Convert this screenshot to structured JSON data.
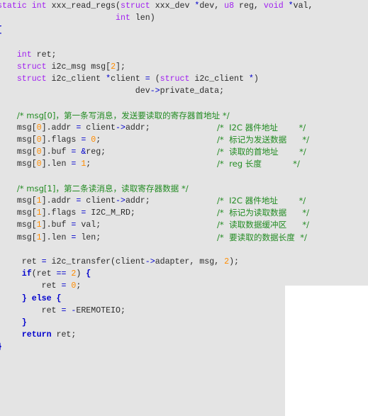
{
  "editor": {
    "language": "C",
    "background_color": "#e4e4e4",
    "comment_color": "#228b22",
    "keyword_color": "#a020f0",
    "control_keyword_color": "#0000cd",
    "number_color": "#ff8c00",
    "identifier_color": "#2b2b2b",
    "operator_color": "#0000cd"
  },
  "overlay": {
    "name": "white-panel",
    "color": "#ffffff"
  },
  "code": {
    "function_name": "xxx_read_regs",
    "lines": [
      {
        "id": "l1",
        "tokens": [
          {
            "t": "static",
            "c": "kw"
          },
          {
            "t": " ",
            "c": "punct"
          },
          {
            "t": "int",
            "c": "kw"
          },
          {
            "t": " ",
            "c": "punct"
          },
          {
            "t": "xxx_read_regs",
            "c": "ident"
          },
          {
            "t": "(",
            "c": "punct"
          },
          {
            "t": "struct",
            "c": "kw"
          },
          {
            "t": " ",
            "c": "punct"
          },
          {
            "t": "xxx_dev",
            "c": "ident"
          },
          {
            "t": " ",
            "c": "punct"
          },
          {
            "t": "*",
            "c": "op"
          },
          {
            "t": "dev, ",
            "c": "ident"
          },
          {
            "t": "u8",
            "c": "kw"
          },
          {
            "t": " ",
            "c": "punct"
          },
          {
            "t": "reg, ",
            "c": "ident"
          },
          {
            "t": "void",
            "c": "kw"
          },
          {
            "t": " ",
            "c": "punct"
          },
          {
            "t": "*",
            "c": "op"
          },
          {
            "t": "val,",
            "c": "ident"
          }
        ]
      },
      {
        "id": "l2",
        "tokens": [
          {
            "t": "                        ",
            "c": "punct"
          },
          {
            "t": "int",
            "c": "kw"
          },
          {
            "t": " ",
            "c": "punct"
          },
          {
            "t": "len)",
            "c": "ident"
          }
        ]
      },
      {
        "id": "l3",
        "tokens": [
          {
            "t": "{",
            "c": "brace"
          }
        ]
      },
      {
        "id": "l4",
        "tokens": []
      },
      {
        "id": "l5",
        "tokens": [
          {
            "t": "    ",
            "c": "punct"
          },
          {
            "t": "int",
            "c": "kw"
          },
          {
            "t": " ret;",
            "c": "ident"
          }
        ]
      },
      {
        "id": "l6",
        "tokens": [
          {
            "t": "    ",
            "c": "punct"
          },
          {
            "t": "struct",
            "c": "kw"
          },
          {
            "t": " i2c_msg msg",
            "c": "ident"
          },
          {
            "t": "[",
            "c": "punct"
          },
          {
            "t": "2",
            "c": "num"
          },
          {
            "t": "];",
            "c": "punct"
          }
        ]
      },
      {
        "id": "l7",
        "tokens": [
          {
            "t": "    ",
            "c": "punct"
          },
          {
            "t": "struct",
            "c": "kw"
          },
          {
            "t": " i2c_client ",
            "c": "ident"
          },
          {
            "t": "*",
            "c": "op"
          },
          {
            "t": "client ",
            "c": "ident"
          },
          {
            "t": "=",
            "c": "op"
          },
          {
            "t": " (",
            "c": "punct"
          },
          {
            "t": "struct",
            "c": "kw"
          },
          {
            "t": " i2c_client ",
            "c": "ident"
          },
          {
            "t": "*",
            "c": "op"
          },
          {
            "t": ")",
            "c": "punct"
          }
        ]
      },
      {
        "id": "l8",
        "tokens": [
          {
            "t": "                            dev",
            "c": "ident"
          },
          {
            "t": "->",
            "c": "op"
          },
          {
            "t": "private_data;",
            "c": "ident"
          }
        ]
      },
      {
        "id": "l9",
        "tokens": []
      },
      {
        "id": "l10",
        "tokens": [
          {
            "t": "    ",
            "c": "punct"
          },
          {
            "t": "/* msg[0]，第一条写消息，发送要读取的寄存器首地址 */",
            "c": "cmt"
          }
        ]
      },
      {
        "id": "l11",
        "tokens": [
          {
            "t": "    msg",
            "c": "ident"
          },
          {
            "t": "[",
            "c": "punct"
          },
          {
            "t": "0",
            "c": "num"
          },
          {
            "t": "].addr ",
            "c": "ident"
          },
          {
            "t": "=",
            "c": "op"
          },
          {
            "t": " client",
            "c": "ident"
          },
          {
            "t": "->",
            "c": "op"
          },
          {
            "t": "addr;",
            "c": "ident"
          }
        ],
        "trailing_comment": "/*  I2C 器件地址        */"
      },
      {
        "id": "l12",
        "tokens": [
          {
            "t": "    msg",
            "c": "ident"
          },
          {
            "t": "[",
            "c": "punct"
          },
          {
            "t": "0",
            "c": "num"
          },
          {
            "t": "].flags ",
            "c": "ident"
          },
          {
            "t": "=",
            "c": "op"
          },
          {
            "t": " ",
            "c": "punct"
          },
          {
            "t": "0",
            "c": "num"
          },
          {
            "t": ";",
            "c": "punct"
          }
        ],
        "trailing_comment": "/*  标记为发送数据      */"
      },
      {
        "id": "l13",
        "tokens": [
          {
            "t": "    msg",
            "c": "ident"
          },
          {
            "t": "[",
            "c": "punct"
          },
          {
            "t": "0",
            "c": "num"
          },
          {
            "t": "].buf ",
            "c": "ident"
          },
          {
            "t": "=",
            "c": "op"
          },
          {
            "t": " ",
            "c": "punct"
          },
          {
            "t": "&",
            "c": "op"
          },
          {
            "t": "reg;",
            "c": "ident"
          }
        ],
        "trailing_comment": "/*  读取的首地址        */"
      },
      {
        "id": "l14",
        "tokens": [
          {
            "t": "    msg",
            "c": "ident"
          },
          {
            "t": "[",
            "c": "punct"
          },
          {
            "t": "0",
            "c": "num"
          },
          {
            "t": "].len ",
            "c": "ident"
          },
          {
            "t": "=",
            "c": "op"
          },
          {
            "t": " ",
            "c": "punct"
          },
          {
            "t": "1",
            "c": "num"
          },
          {
            "t": ";",
            "c": "punct"
          }
        ],
        "trailing_comment": "/*  reg 长度            */"
      },
      {
        "id": "l15",
        "tokens": []
      },
      {
        "id": "l16",
        "tokens": [
          {
            "t": "    ",
            "c": "punct"
          },
          {
            "t": "/* msg[1]，第二条读消息，读取寄存器数据 */",
            "c": "cmt"
          }
        ]
      },
      {
        "id": "l17",
        "tokens": [
          {
            "t": "    msg",
            "c": "ident"
          },
          {
            "t": "[",
            "c": "punct"
          },
          {
            "t": "1",
            "c": "num"
          },
          {
            "t": "].addr ",
            "c": "ident"
          },
          {
            "t": "=",
            "c": "op"
          },
          {
            "t": " client",
            "c": "ident"
          },
          {
            "t": "->",
            "c": "op"
          },
          {
            "t": "addr;",
            "c": "ident"
          }
        ],
        "trailing_comment": "/*  I2C 器件地址        */"
      },
      {
        "id": "l18",
        "tokens": [
          {
            "t": "    msg",
            "c": "ident"
          },
          {
            "t": "[",
            "c": "punct"
          },
          {
            "t": "1",
            "c": "num"
          },
          {
            "t": "].flags ",
            "c": "ident"
          },
          {
            "t": "=",
            "c": "op"
          },
          {
            "t": " I2C_M_RD;",
            "c": "ident"
          }
        ],
        "trailing_comment": "/*  标记为读取数据      */"
      },
      {
        "id": "l19",
        "tokens": [
          {
            "t": "    msg",
            "c": "ident"
          },
          {
            "t": "[",
            "c": "punct"
          },
          {
            "t": "1",
            "c": "num"
          },
          {
            "t": "].buf ",
            "c": "ident"
          },
          {
            "t": "=",
            "c": "op"
          },
          {
            "t": " val;",
            "c": "ident"
          }
        ],
        "trailing_comment": "/*  读取数据缓冲区      */"
      },
      {
        "id": "l20",
        "tokens": [
          {
            "t": "    msg",
            "c": "ident"
          },
          {
            "t": "[",
            "c": "punct"
          },
          {
            "t": "1",
            "c": "num"
          },
          {
            "t": "].len ",
            "c": "ident"
          },
          {
            "t": "=",
            "c": "op"
          },
          {
            "t": " len;",
            "c": "ident"
          }
        ],
        "trailing_comment": "/*  要读取的数据长度  */"
      },
      {
        "id": "l21",
        "tokens": []
      },
      {
        "id": "l22",
        "tokens": [
          {
            "t": "     ret ",
            "c": "ident"
          },
          {
            "t": "=",
            "c": "op"
          },
          {
            "t": " i2c_transfer",
            "c": "ident"
          },
          {
            "t": "(",
            "c": "punct"
          },
          {
            "t": "client",
            "c": "ident"
          },
          {
            "t": "->",
            "c": "op"
          },
          {
            "t": "adapter, msg, ",
            "c": "ident"
          },
          {
            "t": "2",
            "c": "num"
          },
          {
            "t": ");",
            "c": "punct"
          }
        ]
      },
      {
        "id": "l23",
        "tokens": [
          {
            "t": "     ",
            "c": "punct"
          },
          {
            "t": "if",
            "c": "kwb"
          },
          {
            "t": "(ret ",
            "c": "ident"
          },
          {
            "t": "==",
            "c": "op"
          },
          {
            "t": " ",
            "c": "punct"
          },
          {
            "t": "2",
            "c": "num"
          },
          {
            "t": ") ",
            "c": "punct"
          },
          {
            "t": "{",
            "c": "brace"
          }
        ]
      },
      {
        "id": "l24",
        "tokens": [
          {
            "t": "         ret ",
            "c": "ident"
          },
          {
            "t": "=",
            "c": "op"
          },
          {
            "t": " ",
            "c": "punct"
          },
          {
            "t": "0",
            "c": "num"
          },
          {
            "t": ";",
            "c": "punct"
          }
        ]
      },
      {
        "id": "l25",
        "tokens": [
          {
            "t": "     ",
            "c": "punct"
          },
          {
            "t": "}",
            "c": "brace"
          },
          {
            "t": " ",
            "c": "punct"
          },
          {
            "t": "else",
            "c": "kwb"
          },
          {
            "t": " ",
            "c": "punct"
          },
          {
            "t": "{",
            "c": "brace"
          }
        ]
      },
      {
        "id": "l26",
        "tokens": [
          {
            "t": "         ret ",
            "c": "ident"
          },
          {
            "t": "=",
            "c": "op"
          },
          {
            "t": " ",
            "c": "punct"
          },
          {
            "t": "-",
            "c": "op"
          },
          {
            "t": "EREMOTEIO;",
            "c": "ident"
          }
        ]
      },
      {
        "id": "l27",
        "tokens": [
          {
            "t": "     ",
            "c": "punct"
          },
          {
            "t": "}",
            "c": "brace"
          }
        ]
      },
      {
        "id": "l28",
        "tokens": [
          {
            "t": "     ",
            "c": "punct"
          },
          {
            "t": "return",
            "c": "kwb"
          },
          {
            "t": " ret;",
            "c": "ident"
          }
        ]
      },
      {
        "id": "l29",
        "tokens": [
          {
            "t": "}",
            "c": "brace"
          }
        ]
      }
    ]
  }
}
